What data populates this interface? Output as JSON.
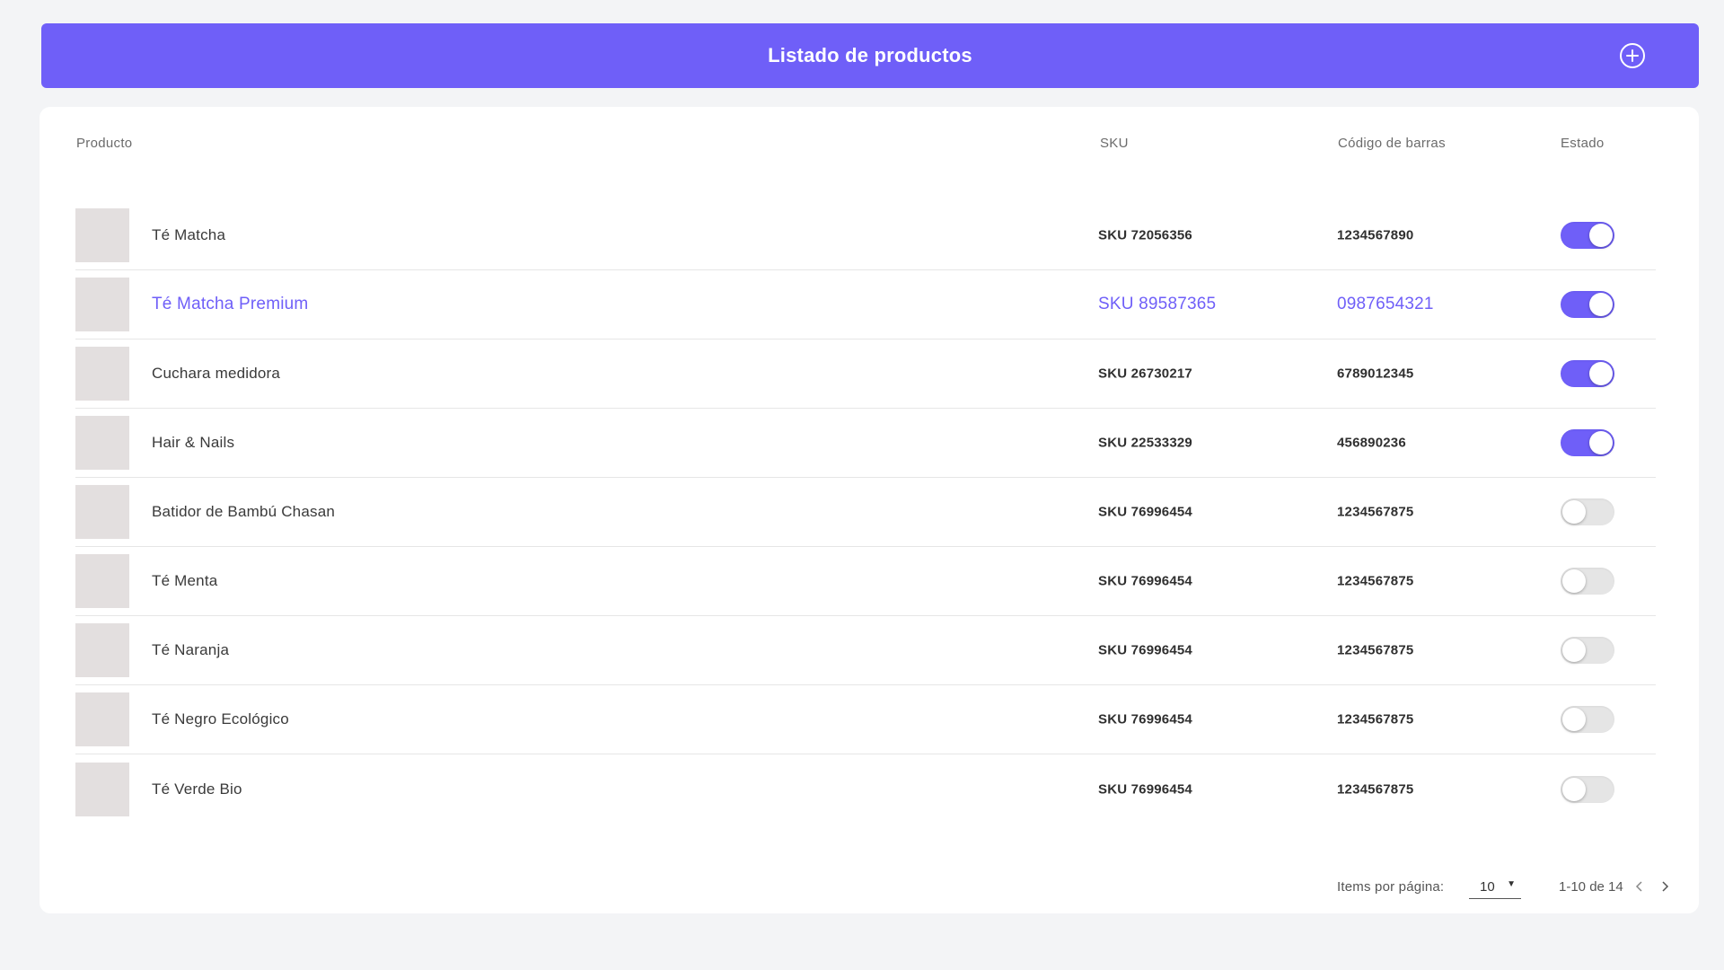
{
  "header": {
    "title": "Listado de productos",
    "add_icon": "plus-circle-icon"
  },
  "table": {
    "columns": {
      "product": "Producto",
      "sku": "SKU",
      "barcode": "Código de barras",
      "state": "Estado"
    },
    "rows": [
      {
        "name": "Té Matcha",
        "sku": "SKU 72056356",
        "barcode": "1234567890",
        "active": true,
        "highlighted": false
      },
      {
        "name": "Té Matcha Premium",
        "sku": "SKU 89587365",
        "barcode": "0987654321",
        "active": true,
        "highlighted": true
      },
      {
        "name": "Cuchara medidora",
        "sku": "SKU 26730217",
        "barcode": "6789012345",
        "active": true,
        "highlighted": false
      },
      {
        "name": "Hair & Nails",
        "sku": "SKU 22533329",
        "barcode": "456890236",
        "active": true,
        "highlighted": false
      },
      {
        "name": "Batidor de Bambú Chasan",
        "sku": "SKU 76996454",
        "barcode": "1234567875",
        "active": false,
        "highlighted": false
      },
      {
        "name": "Té Menta",
        "sku": "SKU 76996454",
        "barcode": "1234567875",
        "active": false,
        "highlighted": false
      },
      {
        "name": "Té Naranja",
        "sku": "SKU 76996454",
        "barcode": "1234567875",
        "active": false,
        "highlighted": false
      },
      {
        "name": "Té Negro Ecológico",
        "sku": "SKU 76996454",
        "barcode": "1234567875",
        "active": false,
        "highlighted": false
      },
      {
        "name": "Té Verde Bio",
        "sku": "SKU 76996454",
        "barcode": "1234567875",
        "active": false,
        "highlighted": false
      }
    ]
  },
  "pagination": {
    "items_label": "Items por página:",
    "page_size": "10",
    "range": "1-10 de 14",
    "prev_icon": "chevron-left-icon",
    "next_icon": "chevron-right-icon"
  },
  "colors": {
    "accent": "#6f5ff8",
    "background": "#f3f4f6",
    "toggle_off": "#e5e5e5",
    "thumb": "#e3dfdf"
  }
}
